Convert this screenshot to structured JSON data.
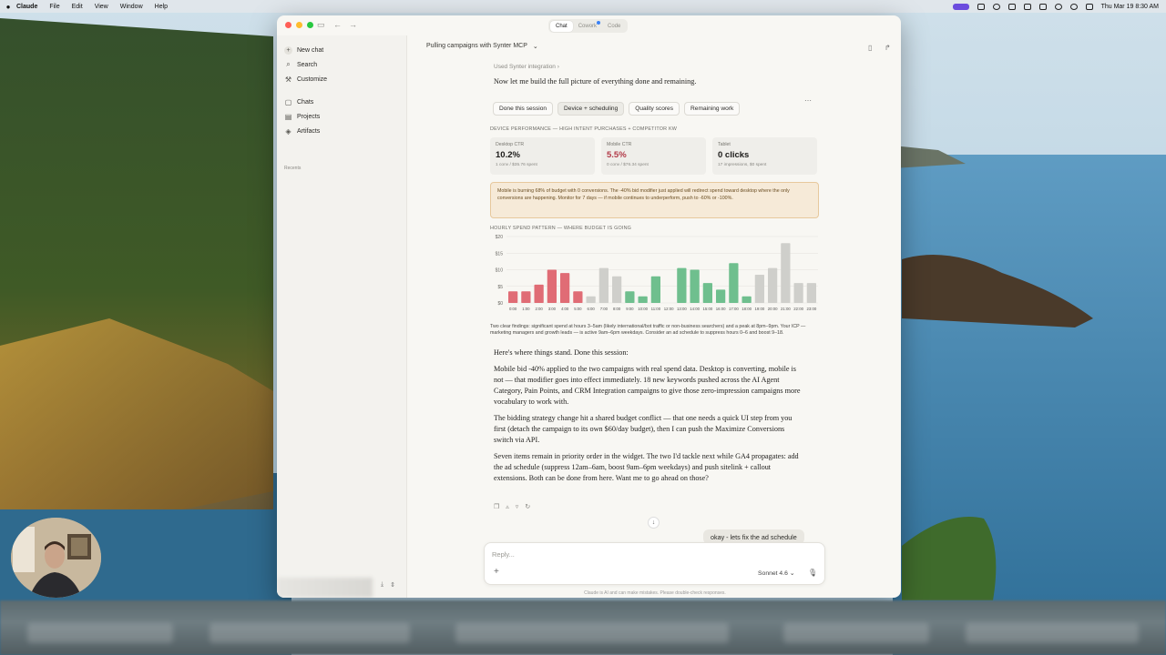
{
  "menubar": {
    "app_name": "Claude",
    "menus": [
      "File",
      "Edit",
      "View",
      "Window",
      "Help"
    ],
    "clock": "Thu Mar 19  8:30 AM"
  },
  "titlebar": {
    "modes": [
      {
        "label": "Chat",
        "active": true
      },
      {
        "label": "Cowork",
        "active": false
      },
      {
        "label": "Code",
        "active": false
      }
    ]
  },
  "sidebar": {
    "new_chat": "New chat",
    "search": "Search",
    "customize": "Customize",
    "chats": "Chats",
    "projects": "Projects",
    "artifacts": "Artifacts",
    "recents": "Recents"
  },
  "chat": {
    "title": "Pulling campaigns with Synter MCP",
    "used_tool": "Used Synter integration",
    "intro": "Now let me build the full picture of everything done and remaining.",
    "paragraphs": [
      "Here's where things stand. Done this session:",
      "Mobile bid -40% applied to the two campaigns with real spend data. Desktop is converting, mobile is not — that modifier goes into effect immediately. 18 new keywords pushed across the AI Agent Category, Pain Points, and CRM Integration campaigns to give those zero-impression campaigns more vocabulary to work with.",
      "The bidding strategy change hit a shared budget conflict — that one needs a quick UI step from you first (detach the campaign to its own $60/day budget), then I can push the Maximize Conversions switch via API.",
      "Seven items remain in priority order in the widget. The two I'd tackle next while GA4 propagates: add the ad schedule (suppress 12am–6am, boost 9am–6pm weekdays) and push sitelink + callout extensions. Both can be done from here. Want me to go ahead on those?"
    ],
    "user_message": "okay - lets fix the ad schedule"
  },
  "widget": {
    "tabs": [
      {
        "label": "Done this session",
        "active": false
      },
      {
        "label": "Device + scheduling",
        "active": true
      },
      {
        "label": "Quality scores",
        "active": false
      },
      {
        "label": "Remaining work",
        "active": false
      }
    ],
    "device_heading": "DEVICE PERFORMANCE — HIGH INTENT PURCHASES + COMPETITOR KW",
    "kpis": [
      {
        "label": "Desktop CTR",
        "value": "10.2%",
        "sub": "1 conv / $35.76 spent",
        "color": "#1c1b19"
      },
      {
        "label": "Mobile CTR",
        "value": "5.5%",
        "sub": "0 conv / $76.34 spent",
        "color": "#b23a48"
      },
      {
        "label": "Tablet",
        "value": "0 clicks",
        "sub": "17 impressions, $0 spent",
        "color": "#1c1b19"
      }
    ],
    "alert": "Mobile is burning 68% of budget with 0 conversions. The -40% bid modifier just applied will redirect spend toward desktop where the only conversions are happening. Monitor for 7 days — if mobile continues to underperform, push to -60% or -100%.",
    "hourly_heading": "HOURLY SPEND PATTERN — WHERE BUDGET IS GOING",
    "chart_note": "Two clear findings: significant spend at hours 3–5am (likely international/bot traffic or non-business searchers) and a peak at 8pm–9pm. Your ICP — marketing managers and growth leads — is active 9am–6pm weekdays. Consider an ad schedule to suppress hours 0–6 and boost 9–18."
  },
  "chart_data": {
    "type": "bar",
    "title": "HOURLY SPEND PATTERN — WHERE BUDGET IS GOING",
    "categories": [
      "0:00",
      "1:00",
      "2:00",
      "3:00",
      "4:00",
      "5:00",
      "6:00",
      "7:00",
      "8:00",
      "9:00",
      "10:00",
      "11:00",
      "12:00",
      "13:00",
      "14:00",
      "15:00",
      "16:00",
      "17:00",
      "18:00",
      "19:00",
      "20:00",
      "21:00",
      "22:00",
      "23:00"
    ],
    "series": [
      {
        "values": [
          3.5,
          3.5,
          5.5,
          10,
          9,
          3.5,
          2,
          10.5,
          8,
          3.5,
          2,
          8,
          0,
          10.5,
          10,
          6,
          4,
          12,
          2,
          8.5,
          10.5,
          18,
          6,
          6
        ]
      }
    ],
    "bar_colors": [
      "#e06c75",
      "#e06c75",
      "#e06c75",
      "#e06c75",
      "#e06c75",
      "#e06c75",
      "#cfcfcb",
      "#cfcfcb",
      "#cfcfcb",
      "#6fbf8e",
      "#6fbf8e",
      "#6fbf8e",
      "#6fbf8e",
      "#6fbf8e",
      "#6fbf8e",
      "#6fbf8e",
      "#6fbf8e",
      "#6fbf8e",
      "#6fbf8e",
      "#cfcfcb",
      "#cfcfcb",
      "#cfcfcb",
      "#cfcfcb",
      "#cfcfcb"
    ],
    "yticks": [
      "$0",
      "$5",
      "$10",
      "$15",
      "$20"
    ],
    "ylim": [
      0,
      20
    ],
    "grid": true
  },
  "composer": {
    "placeholder": "Reply...",
    "model": "Sonnet 4.6",
    "disclaimer": "Claude is AI and can make mistakes. Please double-check responses."
  }
}
